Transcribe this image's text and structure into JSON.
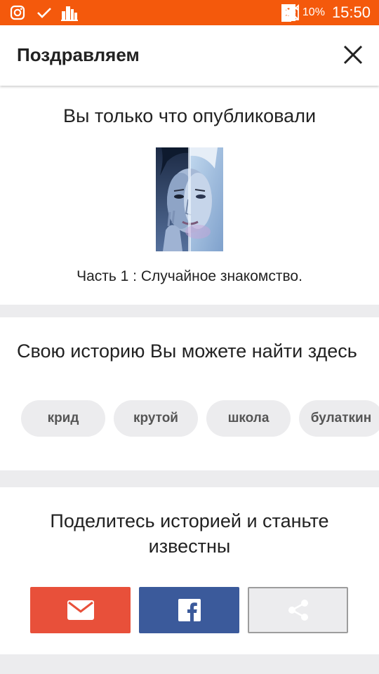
{
  "status_bar": {
    "battery": "10%",
    "sim_slot": "1",
    "time": "15:50"
  },
  "header": {
    "title": "Поздравляем"
  },
  "published": {
    "title": "Вы только что опубликовали",
    "story_part": "Часть 1 : Случайное знакомство."
  },
  "find_story": {
    "title": "Свою историю Вы можете найти здесь",
    "tags": [
      "крид",
      "крутой",
      "школа",
      "булаткин"
    ]
  },
  "share": {
    "title": "Поделитесь историей и станьте известны"
  },
  "colors": {
    "status_bar": "#f4590c",
    "mail": "#e8503a",
    "facebook": "#3b5a9b"
  }
}
